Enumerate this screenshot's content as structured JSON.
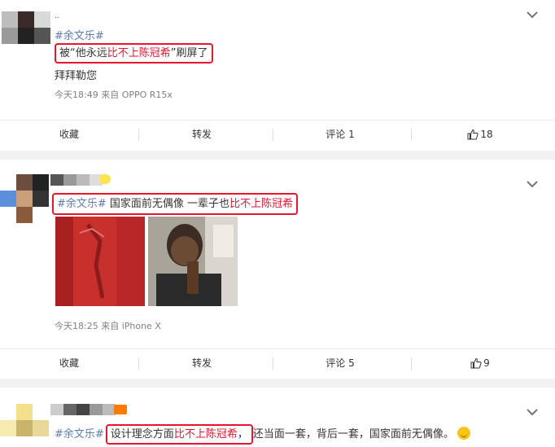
{
  "posts": [
    {
      "name_fragment": "..",
      "hashtag": "#余文乐#",
      "line1_pre": "被“他永远",
      "line1_red": "比不上陈冠希",
      "line1_post": "”刷屏了",
      "line2": "拜拜勒您",
      "meta": "今天18:49  来自 OPPO R15x",
      "actions": {
        "favorite": "收藏",
        "repost": "转发",
        "comment": "评论 1",
        "like": "18"
      }
    },
    {
      "hashtag": "#余文乐#",
      "text_pre": " 国家面前无偶像 一辈子也",
      "text_red": "比不上陈冠希",
      "meta": "今天18:25  来自 iPhone X",
      "actions": {
        "favorite": "收藏",
        "repost": "转发",
        "comment": "评论 5",
        "like": "9"
      }
    },
    {
      "hashtag": "#余文乐#",
      "hl_pre": "设计理念方面",
      "hl_red": "比不上陈冠希",
      "hl_post": "，",
      "text_post": "还当面一套，背后一套，国家面前无偶像。"
    }
  ],
  "colors": {
    "hashtag": "#5b7db4",
    "highlight": "#e6162d",
    "meta": "#808080"
  },
  "icons": [
    "chevron-down-icon",
    "thumbs-up-icon",
    "laughing-emoji-icon"
  ]
}
